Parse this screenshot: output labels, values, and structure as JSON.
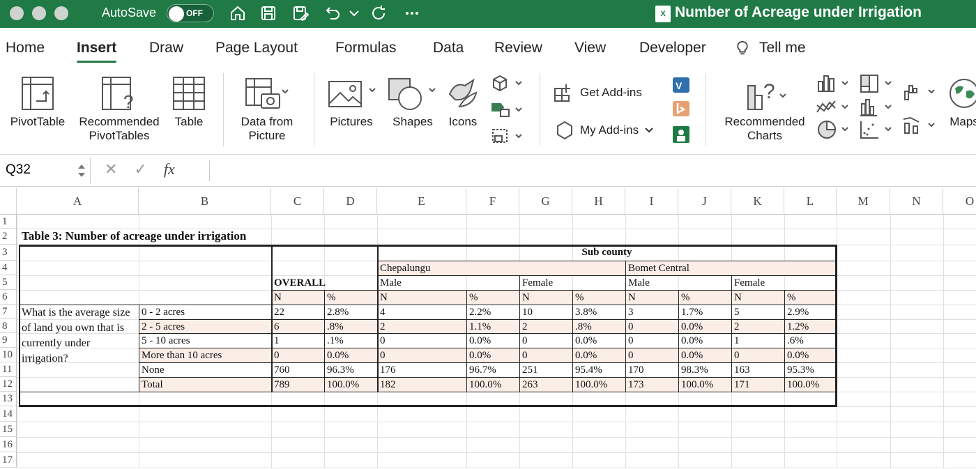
{
  "titlebar": {
    "autosave_label": "AutoSave",
    "autosave_state": "OFF",
    "app_badge": "X",
    "document_title": "Number of Acreage under Irrigation"
  },
  "menu": {
    "tabs": [
      "Home",
      "Insert",
      "Draw",
      "Page Layout",
      "Formulas",
      "Data",
      "Review",
      "View",
      "Developer"
    ],
    "tell_me": "Tell me",
    "active_tab": "Insert"
  },
  "ribbon": {
    "pivot_table": "PivotTable",
    "recommended_pivot_1": "Recommended",
    "recommended_pivot_2": "PivotTables",
    "table": "Table",
    "data_from_picture_1": "Data from",
    "data_from_picture_2": "Picture",
    "pictures": "Pictures",
    "shapes": "Shapes",
    "icons": "Icons",
    "get_addins": "Get Add-ins",
    "my_addins": "My Add-ins",
    "recommended_charts_1": "Recommended",
    "recommended_charts_2": "Charts",
    "maps": "Maps"
  },
  "formula_bar": {
    "name_box": "Q32",
    "fx": "fx",
    "content": ""
  },
  "sheet": {
    "columns": [
      "A",
      "B",
      "C",
      "D",
      "E",
      "F",
      "G",
      "H",
      "I",
      "J",
      "K",
      "L",
      "M",
      "N",
      "O"
    ],
    "rows": [
      "1",
      "2",
      "3",
      "4",
      "5",
      "6",
      "7",
      "8",
      "9",
      "10",
      "11",
      "12",
      "13",
      "14",
      "15",
      "16",
      "17"
    ],
    "table_title": "Table 3: Number of acreage under irrigation",
    "sub_county": "Sub county",
    "overall": "OVERALL",
    "chepalungu": "Chepalungu",
    "bomet_central": "Bomet Central",
    "male": "Male",
    "female": "Female",
    "n": "N",
    "pct": "%",
    "question_lines": [
      "What is the average size",
      "of land you own that is",
      "currently under",
      "irrigation?"
    ],
    "data_rows": [
      {
        "label": "0 - 2 acres",
        "values": [
          "22",
          "2.8%",
          "4",
          "2.2%",
          "10",
          "3.8%",
          "3",
          "1.7%",
          "5",
          "2.9%"
        ]
      },
      {
        "label": "2 - 5 acres",
        "values": [
          "6",
          ".8%",
          "2",
          "1.1%",
          "2",
          ".8%",
          "0",
          "0.0%",
          "2",
          "1.2%"
        ]
      },
      {
        "label": "5 - 10 acres",
        "values": [
          "1",
          ".1%",
          "0",
          "0.0%",
          "0",
          "0.0%",
          "0",
          "0.0%",
          "1",
          ".6%"
        ]
      },
      {
        "label": "More than 10 acres",
        "values": [
          "0",
          "0.0%",
          "0",
          "0.0%",
          "0",
          "0.0%",
          "0",
          "0.0%",
          "0",
          "0.0%"
        ]
      },
      {
        "label": "None",
        "values": [
          "760",
          "96.3%",
          "176",
          "96.7%",
          "251",
          "95.4%",
          "170",
          "98.3%",
          "163",
          "95.3%"
        ]
      },
      {
        "label": "Total",
        "values": [
          "789",
          "100.0%",
          "182",
          "100.0%",
          "263",
          "100.0%",
          "173",
          "100.0%",
          "171",
          "100.0%"
        ]
      }
    ]
  },
  "colors": {
    "brand_green": "#1f7a45",
    "table_shade": "#fbeee6"
  }
}
